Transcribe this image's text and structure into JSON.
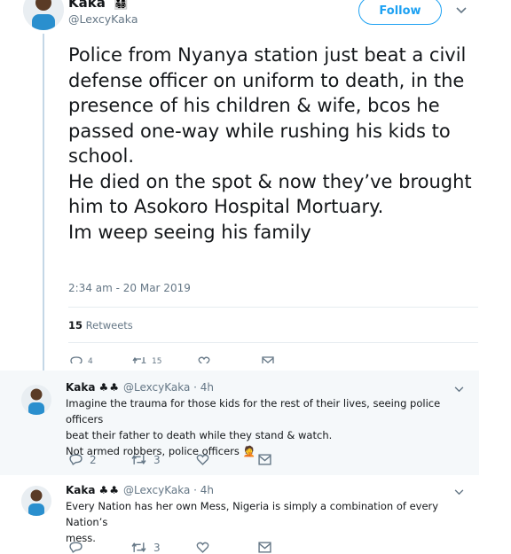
{
  "main_tweet": {
    "author_name": "Kaka",
    "author_emoji": "👨‍👩‍👧‍👦",
    "author_handle": "@LexcyKaka",
    "follow_label": "Follow",
    "text": "Police from Nyanya station just beat a civil defense officer on uniform to death, in the presence of his children & wife, bcos he passed one-way while rushing his kids to school.\nHe died on the spot & now they’ve brought him to Asokoro Hospital Mortuary.\nIm weep seeing his family",
    "timestamp": "2:34 am - 20 Mar 2019",
    "retweet_count": "15",
    "retweet_label": "Retweets",
    "actions": {
      "reply": "4",
      "retweet": "15",
      "like": "",
      "dm": ""
    }
  },
  "replies": [
    {
      "author_name": "Kaka",
      "author_emoji": "♣♣",
      "author_handle": "@LexcyKaka · 4h",
      "text_lines": [
        "Imagine the trauma for those kids for the rest of their lives, seeing police officers",
        "beat their father to death while they stand & watch.",
        "Not armed robbers, police officers 🤦"
      ],
      "reply_count": "2",
      "retweet_count": "3",
      "like_count": ""
    },
    {
      "author_name": "Kaka",
      "author_emoji": "♣♣",
      "author_handle": "@LexcyKaka · 4h",
      "text_lines": [
        "Every Nation has her own Mess, Nigeria is simply a combination of every Nation’s",
        "mess."
      ],
      "reply_count": "",
      "retweet_count": "3",
      "like_count": ""
    }
  ],
  "colors": {
    "accent": "#1da1f2",
    "muted": "#657786",
    "text": "#14171a",
    "thread_line": "#c4d7e6",
    "shaded_bg": "#f5f8fa"
  },
  "icons": [
    "caret-down-icon",
    "reply-icon",
    "retweet-icon",
    "like-icon",
    "dm-icon"
  ]
}
